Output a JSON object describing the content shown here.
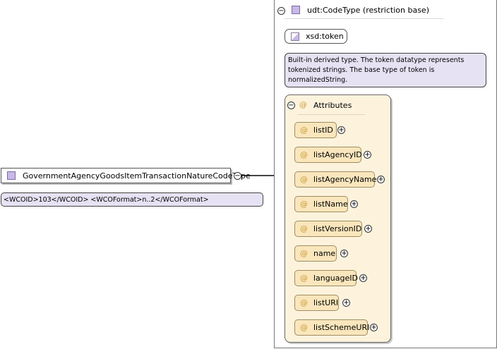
{
  "element": {
    "name": "GovernmentAgencyGoodsItemTransactionNatureCodeType",
    "note": "<WCOID>103</WCOID> <WCOFormat>n..2</WCOFormat>",
    "collapse_glyph": "−"
  },
  "type_panel": {
    "title": "udt:CodeType (restriction base)",
    "collapse_glyph": "−",
    "base_type": "xsd:token",
    "base_doc": "Built-in derived type. The token datatype represents tokenized strings. The base type of token is normalizedString."
  },
  "attributes": {
    "header": "Attributes",
    "at_glyph": "@",
    "collapse_glyph": "−",
    "expand_glyph": "+",
    "items": [
      {
        "label": "listID"
      },
      {
        "label": "listAgencyID"
      },
      {
        "label": "listAgencyName"
      },
      {
        "label": "listName"
      },
      {
        "label": "listVersionID"
      },
      {
        "label": "name"
      },
      {
        "label": "languageID"
      },
      {
        "label": "listURI"
      },
      {
        "label": "listSchemeURI"
      }
    ]
  },
  "colors": {
    "type_square": "#c8b8e8",
    "note_background": "#e6e2f3",
    "attribute_group_background": "#fdf3dd",
    "attribute_item_background": "#fae6bc",
    "at_symbol": "#c89a30"
  },
  "icons": [
    "type-square-icon",
    "collapse-icon",
    "expand-icon",
    "simple-type-icon",
    "attribute-at-icon"
  ]
}
